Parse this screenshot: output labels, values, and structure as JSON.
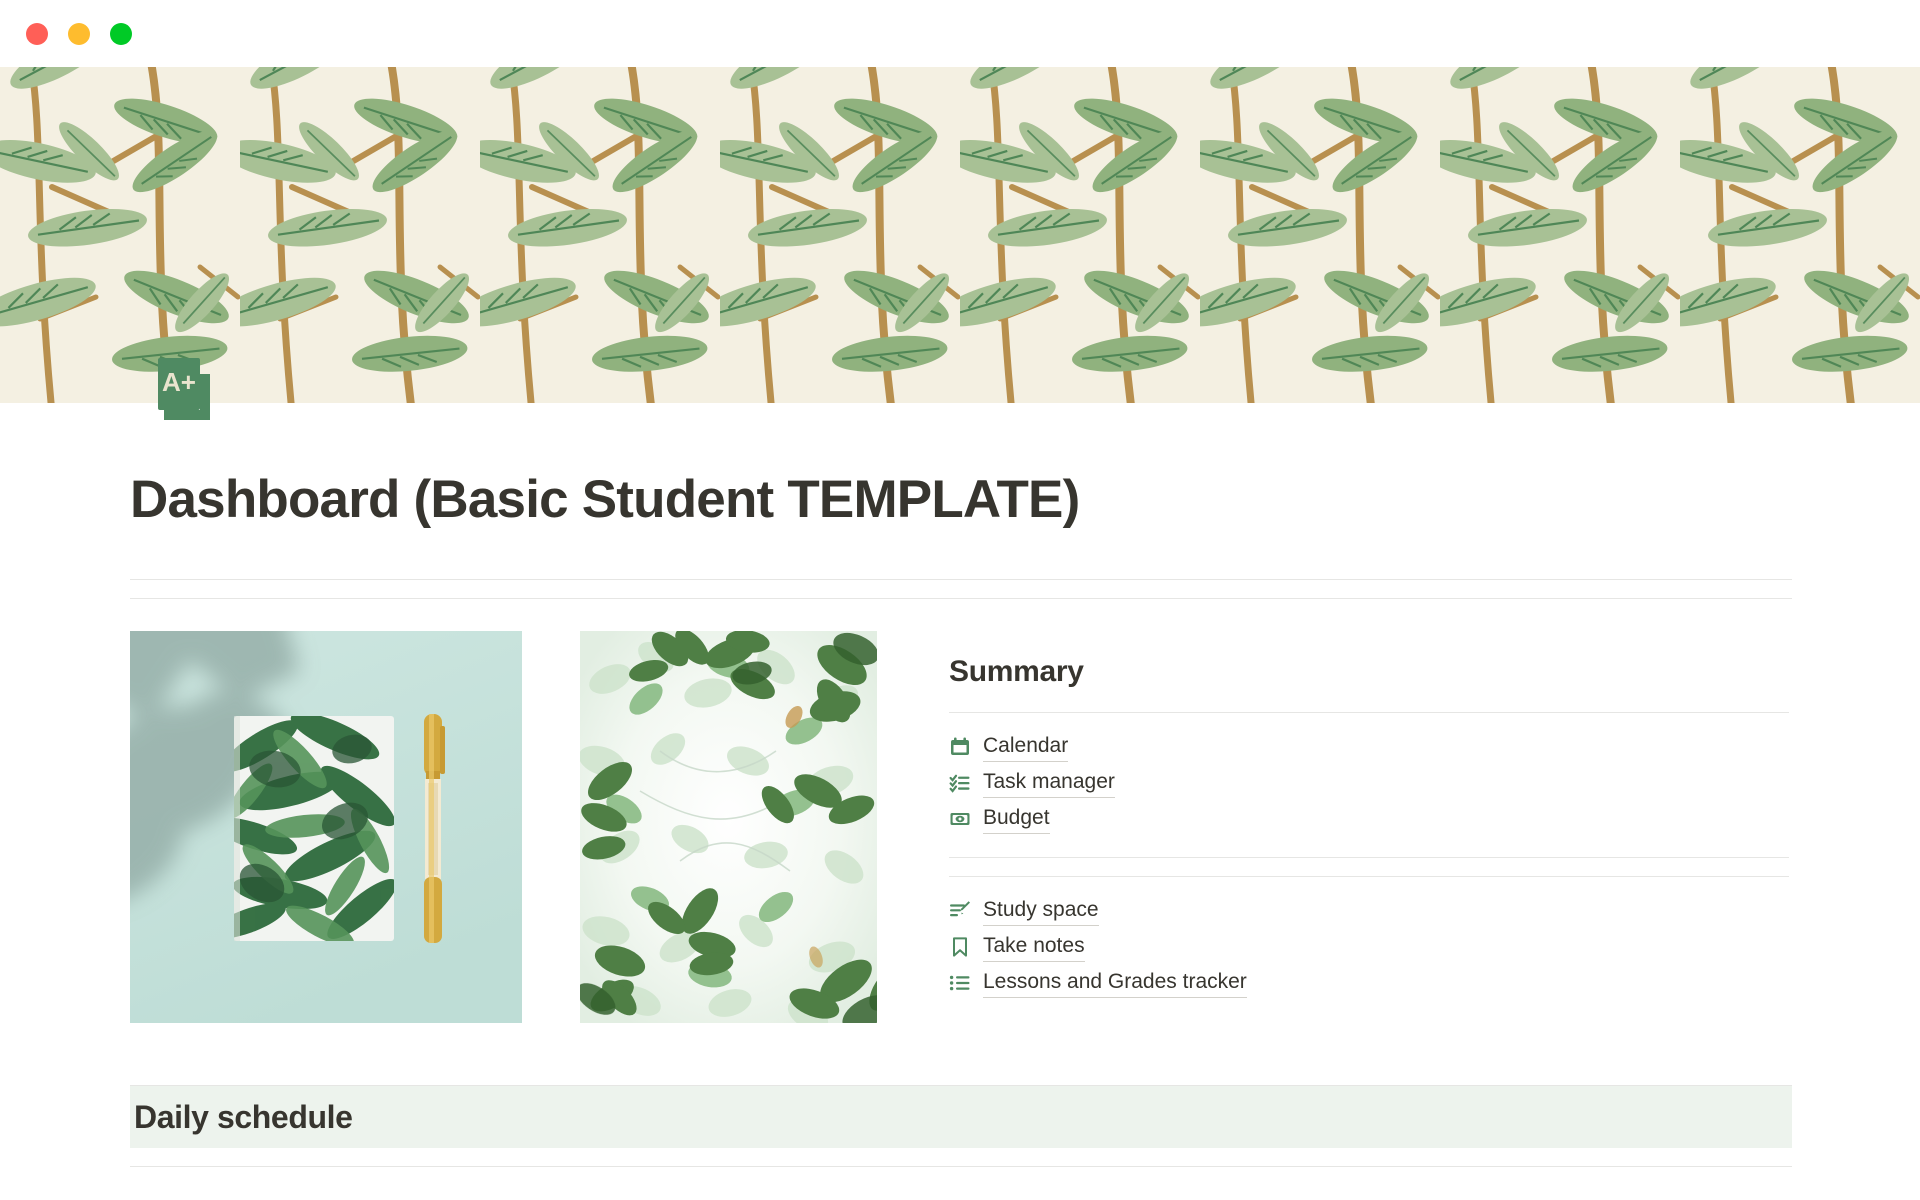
{
  "window": {
    "traffic_lights": [
      {
        "name": "close-button",
        "color": "#FF5F57"
      },
      {
        "name": "minimize-button",
        "color": "#FEBC2E"
      },
      {
        "name": "maximize-button",
        "color": "#00CA26"
      }
    ]
  },
  "cover": {
    "name": "cover-banner",
    "style": "willow-bough-leaf-wallpaper",
    "colors": {
      "background": "#F4F0E2",
      "leaf_light": "#A8C195",
      "leaf_mid": "#90B27E",
      "leaf_vein": "#3F7C4C",
      "stem": "#B8904F"
    }
  },
  "page": {
    "icon": "a-plus-notebook-icon",
    "icon_label": "A+",
    "icon_color": "#4F8A62",
    "title": "Dashboard (Basic Student TEMPLATE)"
  },
  "images": [
    {
      "name": "tropical-notebook-photo",
      "alt": "Palm-print notebook and gold pen on mint background",
      "colors": {
        "background": "#C6E2DC",
        "shadow": "#8FA69F",
        "leaf": "#2E6B3C"
      }
    },
    {
      "name": "green-leaves-photo",
      "alt": "Bright green leaves against white sky",
      "colors": {
        "background": "#FFFFFF",
        "leaf_light": "#BFDCC1",
        "leaf_dark": "#4F7F45"
      }
    }
  ],
  "summary": {
    "heading": "Summary",
    "groups": [
      {
        "links": [
          {
            "icon": "calendar-icon",
            "label": "Calendar"
          },
          {
            "icon": "checklist-icon",
            "label": "Task manager"
          },
          {
            "icon": "money-bill-icon",
            "label": "Budget"
          }
        ]
      },
      {
        "links": [
          {
            "icon": "edit-lines-icon",
            "label": "Study space"
          },
          {
            "icon": "bookmark-icon",
            "label": "Take notes"
          },
          {
            "icon": "bulleted-list-icon",
            "label": "Lessons and Grades tracker"
          }
        ]
      }
    ],
    "icon_color": "#4F8A62"
  },
  "schedule": {
    "title": "Daily schedule",
    "band_color": "#EDF3ED"
  }
}
